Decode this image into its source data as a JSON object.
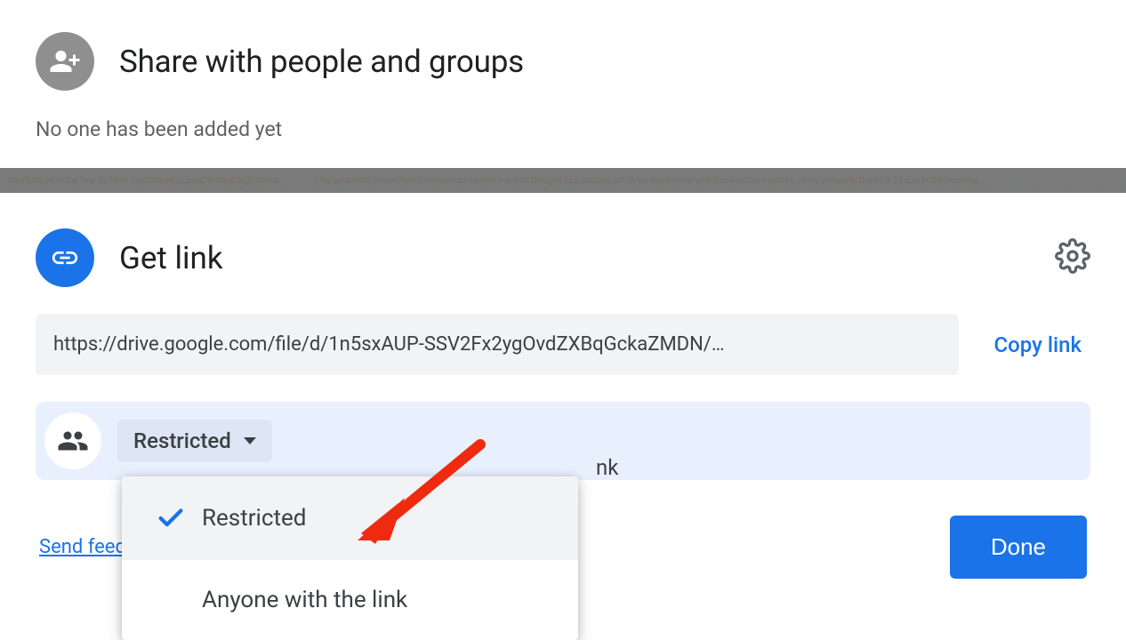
{
  "share": {
    "title": "Share with people and groups",
    "subtext": "No one has been added yet"
  },
  "link": {
    "title": "Get link",
    "url": "https://drive.google.com/file/d/1n5sxAUP-SSV2Fx2ygOvdZXBqGckaZMDN/…",
    "copy_label": "Copy link",
    "access_label": "Restricted",
    "hint_suffix": "nk"
  },
  "dropdown": {
    "options": [
      {
        "label": "Restricted",
        "selected": true
      },
      {
        "label": "Anyone with the link",
        "selected": false
      }
    ]
  },
  "footer": {
    "feedback_label": "Send feed",
    "done_label": "Done"
  },
  "bg_text": {
    "left": "sterification in the liver to form medication is used to treat high blood",
    "right": "This umbilical connection between nature and me was brought to a sudden jolt by an experience which raised the mercury of my curiosity. It was 8.20 a.m in the morning"
  }
}
